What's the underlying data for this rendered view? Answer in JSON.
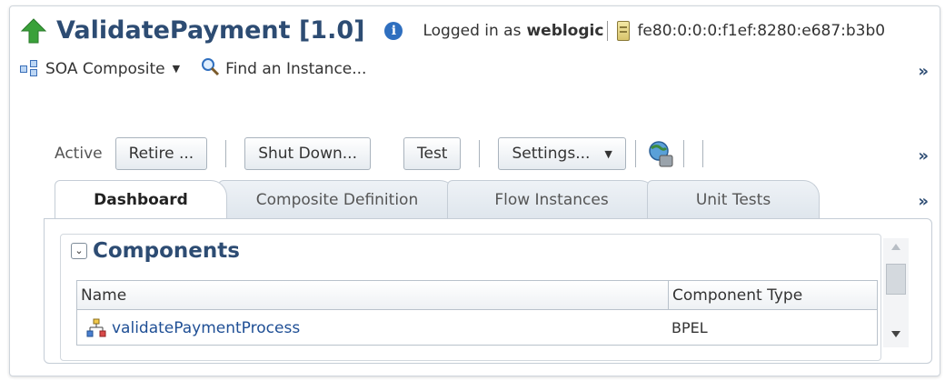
{
  "header": {
    "title": "ValidatePayment [1.0]",
    "logged_in_label": "Logged in as",
    "username": "weblogic",
    "host": "fe80:0:0:0:f1ef:8280:e687:b3b0"
  },
  "menu": {
    "soa_composite_label": "SOA Composite",
    "find_instance_label": "Find an Instance...",
    "more": "»"
  },
  "toolbar": {
    "status": "Active",
    "retire_label": "Retire ...",
    "shutdown_label": "Shut Down...",
    "test_label": "Test",
    "settings_label": "Settings...",
    "more": "»"
  },
  "tabs": [
    {
      "label": "Dashboard",
      "active": true
    },
    {
      "label": "Composite Definition",
      "active": false
    },
    {
      "label": "Flow Instances",
      "active": false
    },
    {
      "label": "Unit Tests",
      "active": false
    }
  ],
  "tabs_more": "»",
  "components": {
    "title": "Components",
    "columns": [
      "Name",
      "Component Type"
    ],
    "rows": [
      {
        "name": "validatePaymentProcess",
        "type": "BPEL"
      }
    ]
  },
  "icons": {
    "up_arrow": "up-arrow-icon",
    "info": "info-icon",
    "server": "server-icon",
    "soa": "soa-composite-icon",
    "find": "magnifier-icon",
    "globe": "globe-icon",
    "bpel": "bpel-process-icon"
  },
  "colors": {
    "title": "#2d4c73",
    "up_arrow": "#3aa13a",
    "link": "#1f4f95"
  }
}
